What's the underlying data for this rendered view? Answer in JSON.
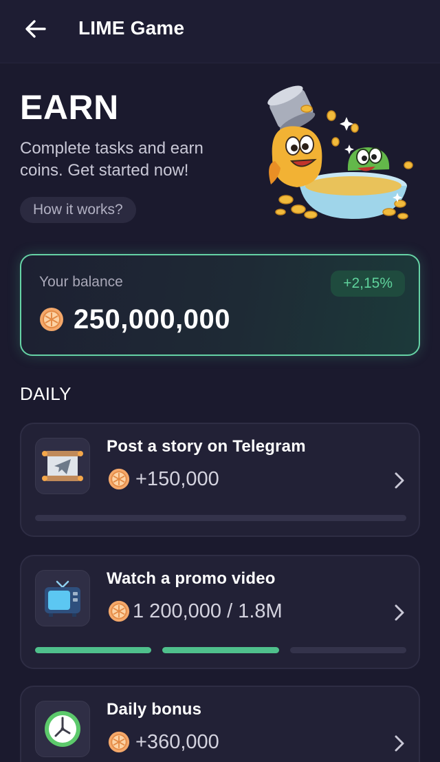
{
  "header": {
    "title": "LIME Game",
    "back_icon": "arrow-left-icon"
  },
  "hero": {
    "title": "EARN",
    "subtitle": "Complete tasks and earn coins. Get started now!",
    "how_it_works_label": "How it works?"
  },
  "balance": {
    "label": "Your balance",
    "value": "250,000,000",
    "change": "+2,15%",
    "icon": "coin-icon"
  },
  "daily": {
    "title": "DAILY",
    "tasks": [
      {
        "title": "Post a story on Telegram",
        "reward": "+150,000",
        "icon": "telegram-scroll-icon",
        "progress_segments": 1,
        "progress_filled": 0
      },
      {
        "title": "Watch a promo video",
        "reward": "1 200,000 / 1.8M",
        "icon": "tv-icon",
        "progress_segments": 3,
        "progress_filled": 2
      },
      {
        "title": "Daily bonus",
        "reward": "+360,000",
        "icon": "clock-icon"
      }
    ]
  },
  "colors": {
    "background": "#1b1a2e",
    "accent_green": "#5fd39c",
    "card": "#222136",
    "coin": "#f0a060"
  }
}
